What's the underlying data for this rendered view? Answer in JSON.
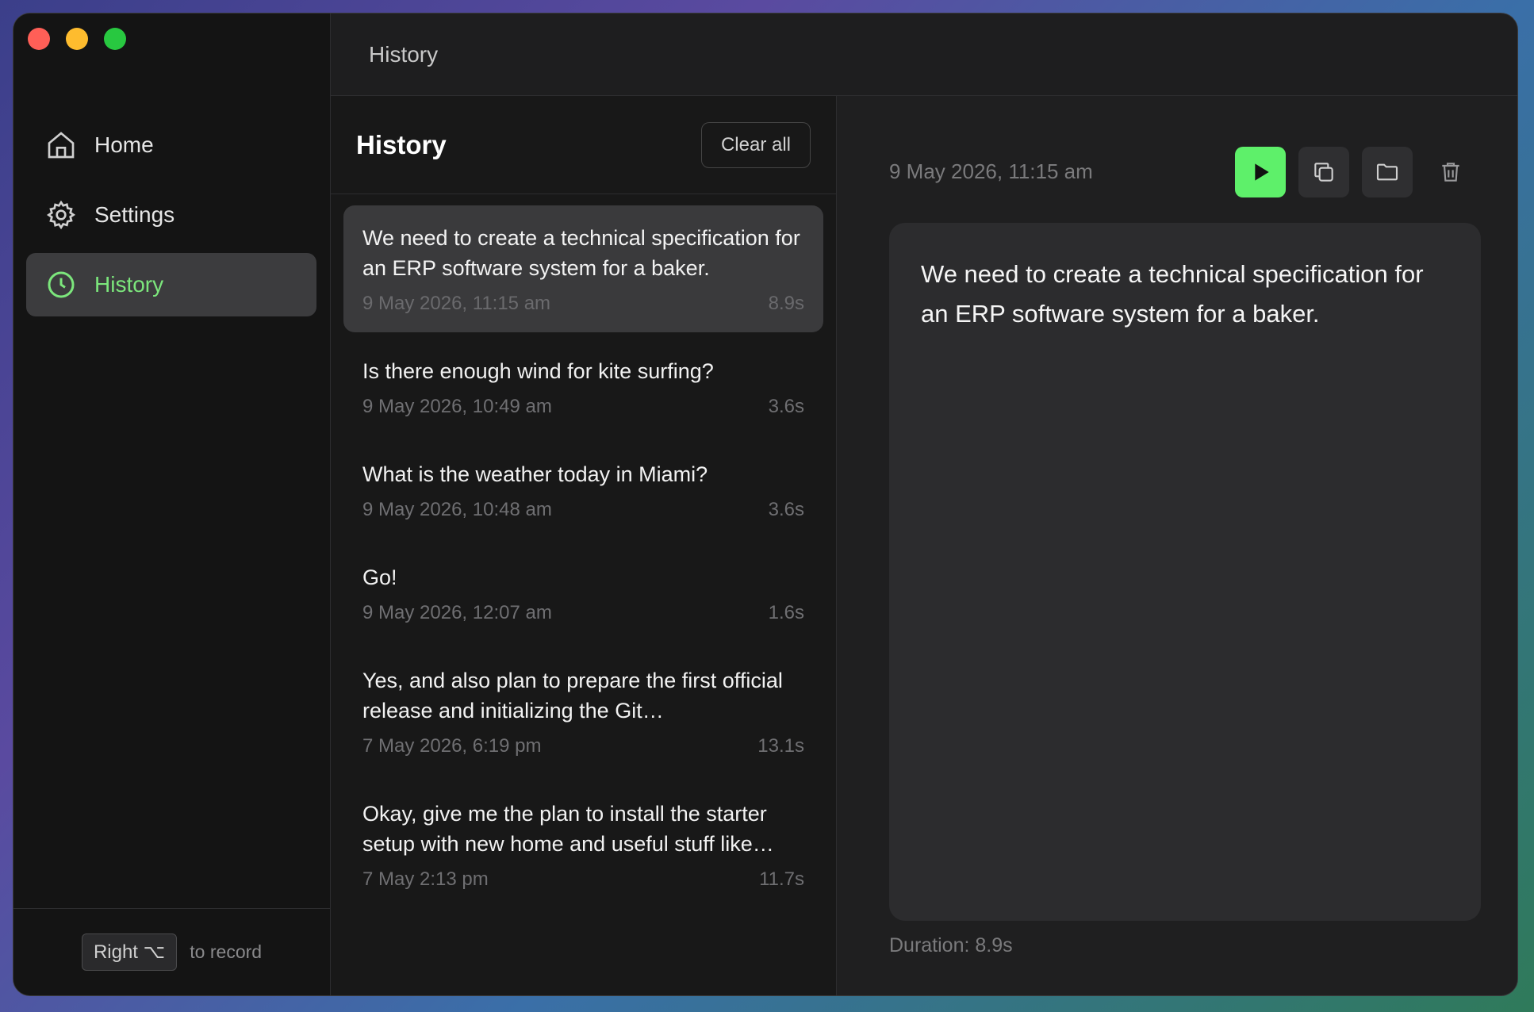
{
  "nav": {
    "items": [
      {
        "label": "Home",
        "icon": "home-icon"
      },
      {
        "label": "Settings",
        "icon": "gear-icon"
      },
      {
        "label": "History",
        "icon": "clock-icon"
      }
    ],
    "active": "History"
  },
  "footer": {
    "key": "Right ⌥",
    "hint": "to record"
  },
  "topbar": {
    "title": "History"
  },
  "list": {
    "title": "History",
    "clear_label": "Clear all",
    "items": [
      {
        "text": "We need to create a technical specification for an ERP software system for a baker.",
        "date": "9 May 2026, 11:15 am",
        "duration": "8.9s"
      },
      {
        "text": "Is there enough wind for kite surfing?",
        "date": "9 May 2026, 10:49 am",
        "duration": "3.6s"
      },
      {
        "text": "What is the weather today in Miami?",
        "date": "9 May 2026, 10:48 am",
        "duration": "3.6s"
      },
      {
        "text": "Go!",
        "date": "9 May 2026, 12:07 am",
        "duration": "1.6s"
      },
      {
        "text": "Yes, and also plan to prepare the first official release and initializing the Git…",
        "date": "7 May 2026, 6:19 pm",
        "duration": "13.1s"
      },
      {
        "text": "Okay, give me the plan to install the starter setup with new home and useful stuff like…",
        "date": "7 May 2:13 pm",
        "duration": "11.7s"
      }
    ]
  },
  "detail": {
    "date": "9 May 2026, 11:15 am",
    "text": "We need to create a technical specification for an ERP software system for a baker.",
    "duration": "Duration: 8.9s"
  },
  "colors": {
    "accent": "#7ce67c",
    "play": "#5ef06a"
  }
}
